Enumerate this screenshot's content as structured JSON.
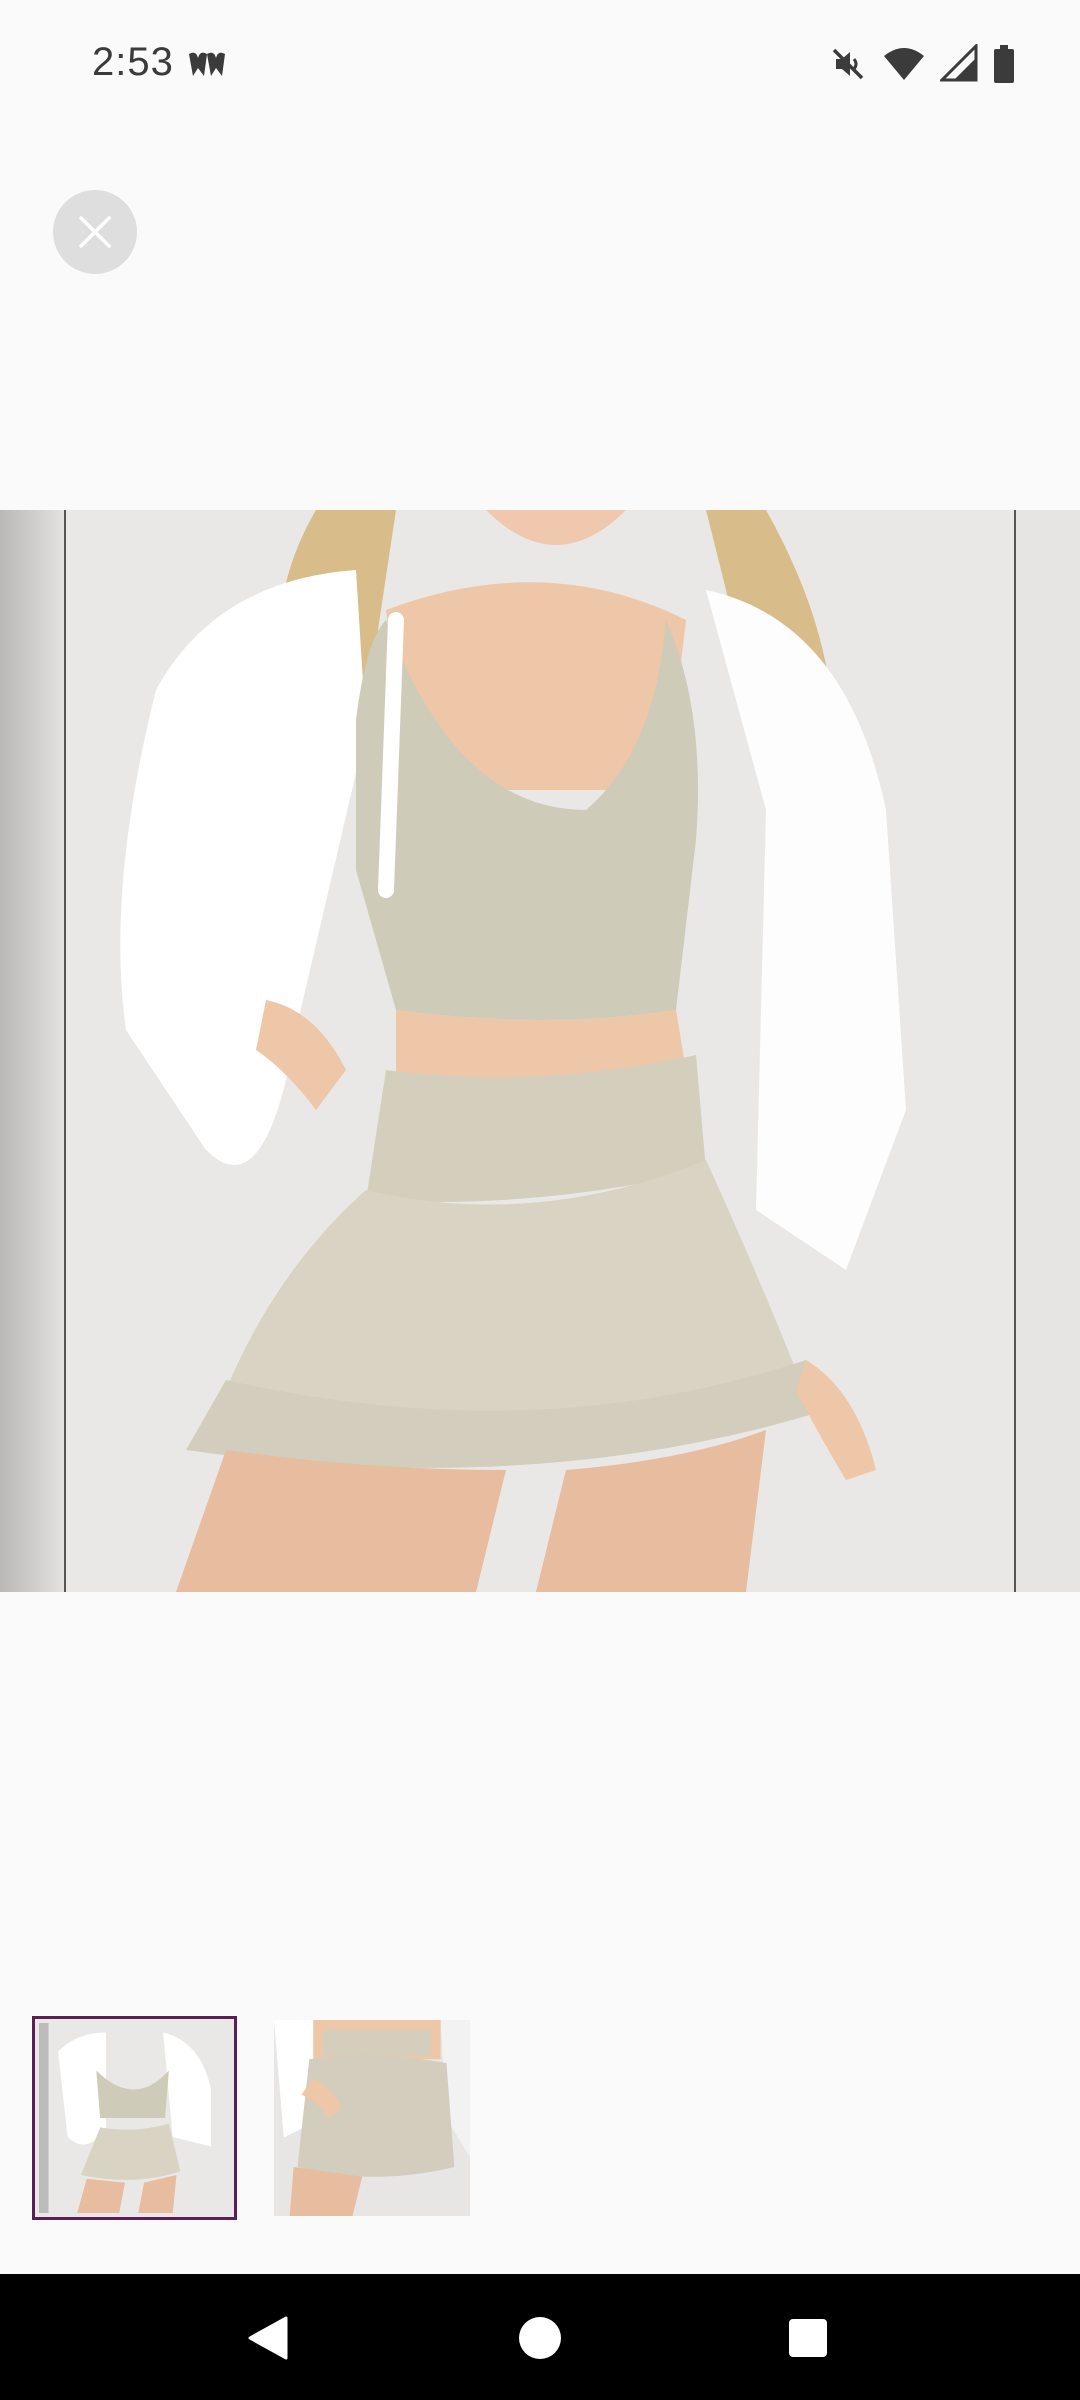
{
  "status_bar": {
    "time": "2:53",
    "icons": [
      "app-notification-icon",
      "mute-icon",
      "wifi-icon",
      "cell-signal-icon",
      "battery-icon"
    ]
  },
  "viewer": {
    "close_icon": "close-icon",
    "images": [
      {
        "name": "product-image-1",
        "selected": true
      },
      {
        "name": "product-image-2",
        "selected": false
      }
    ],
    "colors": {
      "thumbnail_selected_border": "#5a1f57",
      "close_button_bg": "#dedede",
      "background": "#fafafa"
    }
  },
  "nav_bar": {
    "icons": [
      "back-icon",
      "home-icon",
      "recents-icon"
    ]
  }
}
